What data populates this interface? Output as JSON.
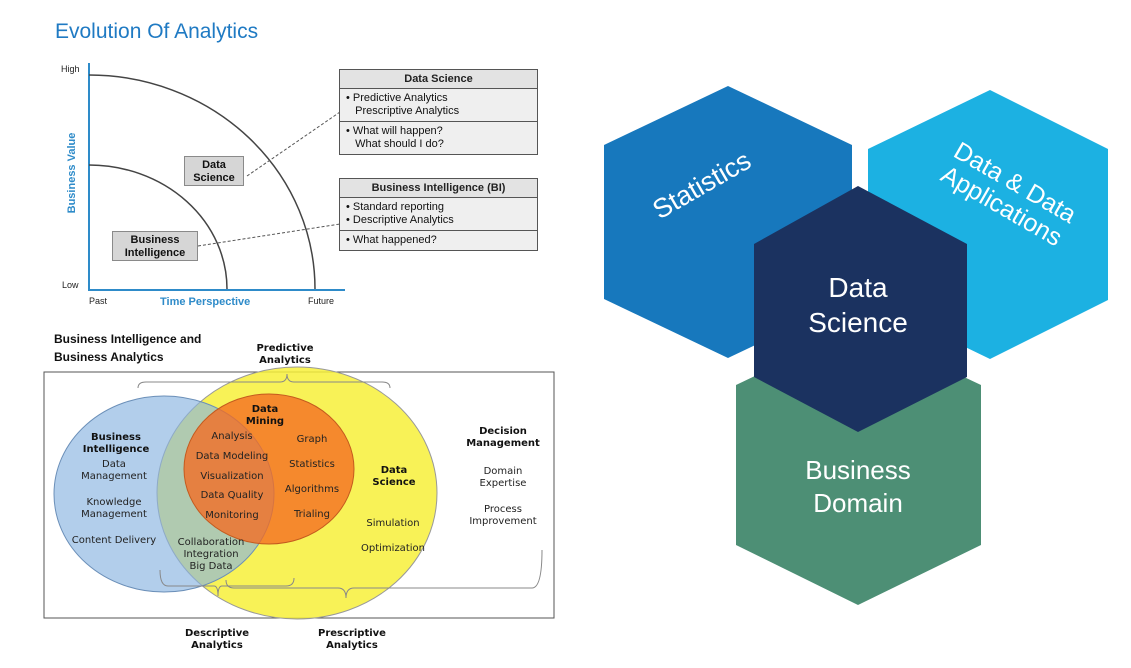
{
  "evolution": {
    "title": "Evolution Of Analytics",
    "y_high": "High",
    "y_low": "Low",
    "y_axis": "Business Value",
    "x_past": "Past",
    "x_future": "Future",
    "x_axis": "Time Perspective",
    "ds_box": [
      "Data",
      "Science"
    ],
    "bi_box": [
      "Business",
      "Intelligence"
    ],
    "ds_panel": {
      "header": "Data Science",
      "row1": [
        "• Predictive Analytics",
        "   Prescriptive Analytics"
      ],
      "row2": [
        "• What will happen?",
        "   What should I do?"
      ]
    },
    "bi_panel": {
      "header": "Business Intelligence (BI)",
      "row1": [
        "• Standard reporting",
        "• Descriptive Analytics"
      ],
      "row2": [
        "• What happened?"
      ]
    }
  },
  "venn": {
    "title": [
      "Business Intelligence and",
      "Business Analytics"
    ],
    "predictive": [
      "Predictive",
      "Analytics"
    ],
    "descriptive": [
      "Descriptive",
      "Analytics"
    ],
    "prescriptive": [
      "Prescriptive",
      "Analytics"
    ],
    "bi_title": [
      "Business",
      "Intelligence"
    ],
    "bi_items": [
      "Data",
      "Management",
      "Knowledge",
      "Management",
      "Content Delivery"
    ],
    "dm_title": [
      "Data",
      "Mining"
    ],
    "dm_left": [
      "Analysis",
      "Data Modeling",
      "Visualization",
      "Data Quality",
      "Monitoring"
    ],
    "dm_right": [
      "Graph",
      "Statistics",
      "Algorithms",
      "Trialing"
    ],
    "overlap": [
      "Collaboration",
      "Integration",
      "Big Data"
    ],
    "ds_title": [
      "Data",
      "Science"
    ],
    "ds_items": [
      "Simulation",
      "Optimization"
    ],
    "decision_title": [
      "Decision",
      "Management"
    ],
    "decision_items": [
      "Domain",
      "Expertise",
      "Process",
      "Improvement"
    ]
  },
  "hexagons": {
    "statistics": "Statistics",
    "data_apps": [
      "Data & Data",
      "Applications"
    ],
    "data_science": [
      "Data",
      "Science"
    ],
    "business_domain": [
      "Business",
      "Domain"
    ],
    "colors": {
      "statistics": "#1778bd",
      "data_apps": "#1cb1e2",
      "data_science": "#1b3260",
      "business_domain": "#4d8f75"
    }
  }
}
